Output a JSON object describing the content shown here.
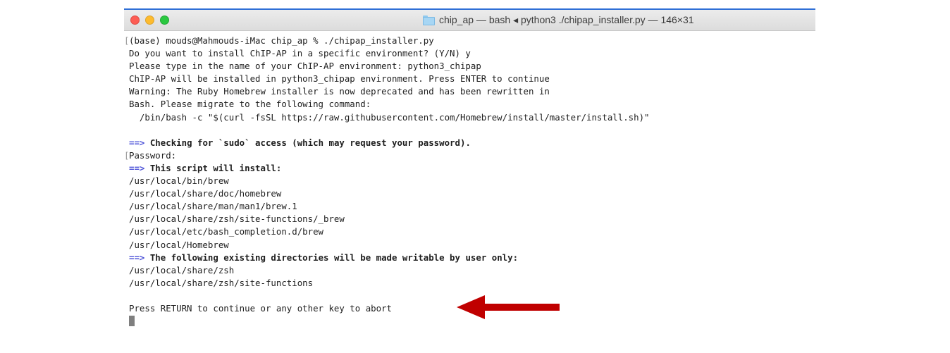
{
  "window": {
    "title": "chip_ap — bash ◂ python3 ./chipap_installer.py — 146×31"
  },
  "terminal": {
    "lines": [
      {
        "mark": "[",
        "text": "(base) mouds@Mahmouds-iMac chip_ap % ./chipap_installer.py"
      },
      {
        "text": "Do you want to install ChIP-AP in a specific environment? (Y/N) y"
      },
      {
        "text": "Please type in the name of your ChIP-AP environment: python3_chipap"
      },
      {
        "text": "ChIP-AP will be installed in python3_chipap environment. Press ENTER to continue"
      },
      {
        "text": "Warning: The Ruby Homebrew installer is now deprecated and has been rewritten in"
      },
      {
        "text": "Bash. Please migrate to the following command:"
      },
      {
        "text": "  /bin/bash -c \"$(curl -fsSL https://raw.githubusercontent.com/Homebrew/install/master/install.sh)\""
      },
      {
        "text": ""
      },
      {
        "prefix": "==>",
        "text": " Checking for `sudo` access (which may request your password).",
        "bold": true
      },
      {
        "mark": "[",
        "text": "Password:"
      },
      {
        "prefix": "==>",
        "text": " This script will install:",
        "bold": true
      },
      {
        "text": "/usr/local/bin/brew"
      },
      {
        "text": "/usr/local/share/doc/homebrew"
      },
      {
        "text": "/usr/local/share/man/man1/brew.1"
      },
      {
        "text": "/usr/local/share/zsh/site-functions/_brew"
      },
      {
        "text": "/usr/local/etc/bash_completion.d/brew"
      },
      {
        "text": "/usr/local/Homebrew"
      },
      {
        "prefix": "==>",
        "text": " The following existing directories will be made writable by user only:",
        "bold": true
      },
      {
        "text": "/usr/local/share/zsh"
      },
      {
        "text": "/usr/local/share/zsh/site-functions"
      },
      {
        "text": ""
      },
      {
        "text": "Press RETURN to continue or any other key to abort"
      }
    ]
  },
  "colors": {
    "prompt_arrow": "#4f55d8",
    "annotation_arrow": "#c00000"
  },
  "icons": {
    "folder": "folder-icon",
    "annotation": "red-arrow-icon"
  }
}
